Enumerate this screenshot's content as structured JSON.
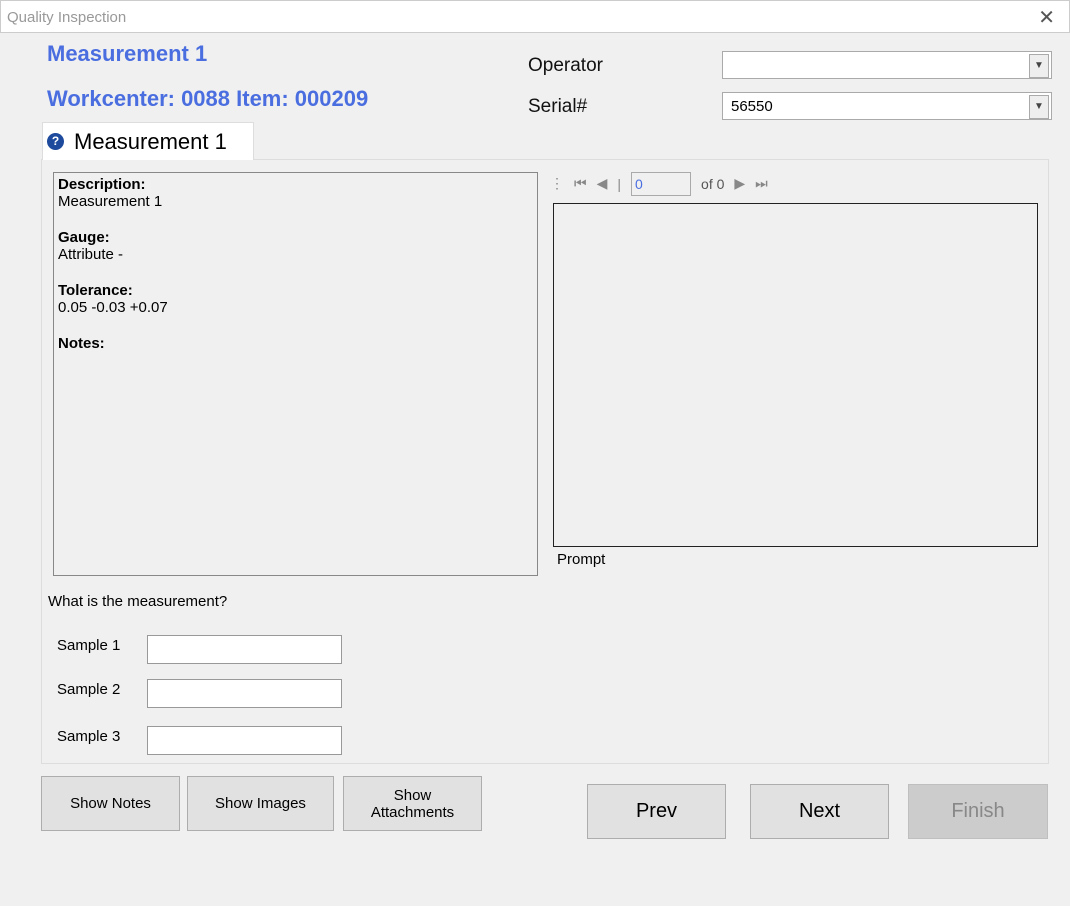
{
  "window": {
    "title": "Quality Inspection"
  },
  "header": {
    "title": "Measurement 1",
    "subtitle": "Workcenter: 0088 Item: 000209",
    "operator_label": "Operator",
    "operator_value": "",
    "serial_label": "Serial#",
    "serial_value": "56550"
  },
  "tab": {
    "label": "Measurement 1",
    "icon": "help-icon"
  },
  "info": {
    "description_label": "Description:",
    "description": "Measurement 1",
    "gauge_label": "Gauge:",
    "gauge": "Attribute -",
    "tolerance_label": "Tolerance:",
    "tolerance": "0.05 -0.03 +0.07",
    "notes_label": "Notes:"
  },
  "navigator": {
    "position": "0",
    "of": "of 0"
  },
  "prompt_label": "Prompt",
  "question": "What is the measurement?",
  "samples": [
    {
      "label": "Sample 1",
      "value": ""
    },
    {
      "label": "Sample 2",
      "value": ""
    },
    {
      "label": "Sample 3",
      "value": ""
    }
  ],
  "buttons": {
    "show_notes": "Show Notes",
    "show_images": "Show Images",
    "show_attachments": "Show Attachments",
    "prev": "Prev",
    "next": "Next",
    "finish": "Finish"
  }
}
